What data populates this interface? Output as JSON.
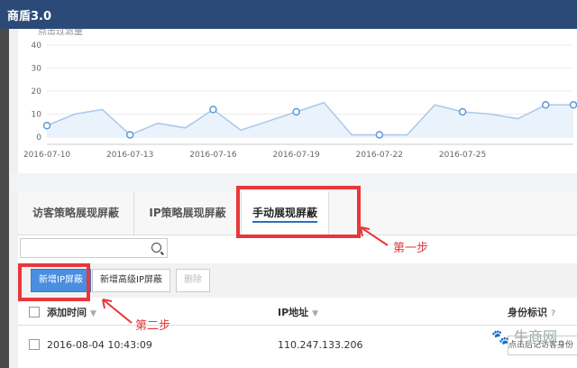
{
  "app": {
    "title": "商盾3.0"
  },
  "chart_data": {
    "type": "line",
    "ylabel": "点击过滤量",
    "ylim": [
      0,
      40
    ],
    "yticks": [
      0,
      10,
      20,
      30,
      40
    ],
    "xticks": [
      "2016-07-10",
      "2016-07-13",
      "2016-07-16",
      "2016-07-19",
      "2016-07-22",
      "2016-07-25"
    ],
    "series": [
      {
        "values": [
          5,
          10,
          12,
          1,
          6,
          4,
          12,
          3,
          7,
          11,
          15,
          1,
          1,
          1,
          14,
          11,
          10,
          8,
          14,
          14
        ]
      }
    ],
    "markers": [
      0,
      3,
      6,
      9,
      12,
      15,
      18,
      19
    ]
  },
  "tabs": [
    "访客策略展现屏蔽",
    "IP策略展现屏蔽",
    "手动展现屏蔽"
  ],
  "toolbar": {
    "add_ip": "新增IP屏蔽",
    "add_adv": "新增高级IP屏蔽",
    "delete": "删除"
  },
  "table": {
    "headers": [
      "添加时间",
      "IP地址",
      "身份标识"
    ],
    "row": {
      "time": "2016-08-04 10:43:09",
      "ip": "110.247.133.206",
      "action": "点击后记访客身份"
    }
  },
  "annotations": {
    "step1": "第一步",
    "step2": "第二步"
  },
  "watermark": "牛商网",
  "colors": {
    "header": "#2c4a78",
    "accent": "#4a8ee0",
    "highlight": "#e8373a",
    "line": "#a8c8ea"
  }
}
